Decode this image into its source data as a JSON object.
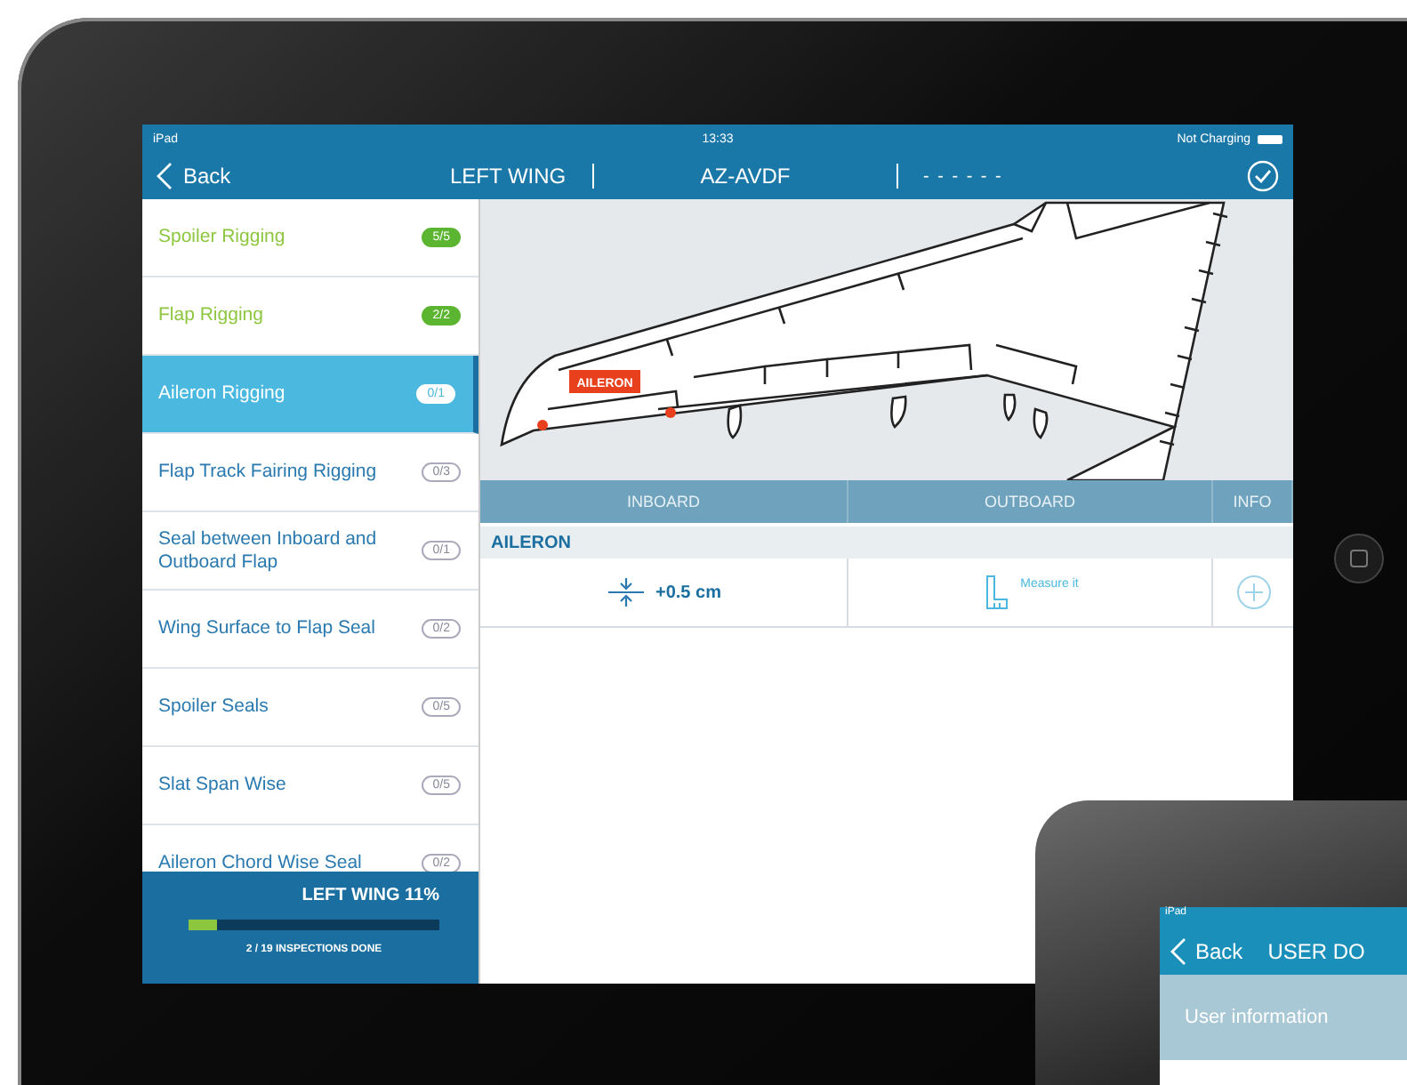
{
  "tablet": {
    "status_bar": {
      "device": "iPad",
      "time": "13:33",
      "power": "Not Charging"
    },
    "nav_bar": {
      "back": "Back",
      "section": "LEFT WING",
      "registration": "AZ-AVDF",
      "placeholder": "- - - - - -"
    },
    "sidebar": {
      "items": [
        {
          "label": "Spoiler Rigging",
          "count": "5/5",
          "done": true,
          "selected": false
        },
        {
          "label": "Flap Rigging",
          "count": "2/2",
          "done": true,
          "selected": false
        },
        {
          "label": "Aileron Rigging",
          "count": "0/1",
          "done": false,
          "selected": true
        },
        {
          "label": "Flap Track Fairing Rigging",
          "count": "0/3",
          "done": false,
          "selected": false
        },
        {
          "label": "Seal between Inboard and Outboard Flap",
          "count": "0/1",
          "done": false,
          "selected": false
        },
        {
          "label": "Wing Surface to Flap Seal",
          "count": "0/2",
          "done": false,
          "selected": false
        },
        {
          "label": "Spoiler Seals",
          "count": "0/5",
          "done": false,
          "selected": false
        },
        {
          "label": "Slat Span Wise",
          "count": "0/5",
          "done": false,
          "selected": false
        },
        {
          "label": "Aileron Chord Wise Seal",
          "count": "0/2",
          "done": false,
          "selected": false
        }
      ],
      "progress": {
        "title": "LEFT WING 11%",
        "level": 0.11,
        "caption": "2 / 19 INSPECTIONS DONE"
      }
    },
    "diagram": {
      "callout": "AILERON"
    },
    "table": {
      "columns": [
        "INBOARD",
        "OUTBOARD",
        "INFO"
      ],
      "section": "AILERON",
      "row": {
        "inboard": "+0.5 cm",
        "outboard": "Measure it"
      }
    }
  },
  "second_tablet": {
    "status_bar": {
      "device": "iPad"
    },
    "nav_bar": {
      "back": "Back",
      "title": "USER DO"
    },
    "section": "User information"
  }
}
